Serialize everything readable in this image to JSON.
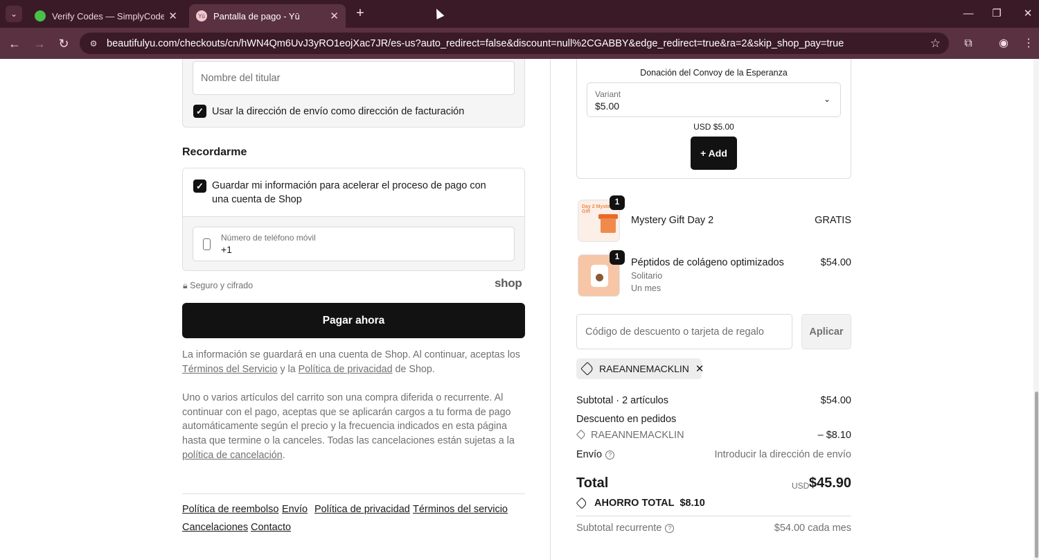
{
  "browser": {
    "tabs": [
      {
        "title": "Verify Codes — SimplyCodes",
        "active": false
      },
      {
        "title": "Pantalla de pago - Yū",
        "active": true
      }
    ],
    "url": "beautifulyu.com/checkouts/cn/hWN4Qm6UvJ3yRO1eojXac7JR/es-us?auto_redirect=false&discount=null%2CGABBY&edge_redirect=true&ra=2&skip_shop_pay=true"
  },
  "billing": {
    "holder_placeholder": "Nombre del titular",
    "use_shipping_label": "Usar la dirección de envío como dirección de facturación",
    "use_shipping_checked": true
  },
  "remember": {
    "heading": "Recordarme",
    "save_info_label": "Guardar mi información para acelerar el proceso de pago con una cuenta de Shop",
    "save_info_checked": true,
    "phone_label": "Número de teléfono móvil",
    "phone_value": "+1",
    "secure_text": "Seguro y cifrado",
    "shop_brand": "shop"
  },
  "pay_button": "Pagar ahora",
  "legal": {
    "para1_pre": "La información se guardará en una cuenta de Shop. Al continuar, aceptas los ",
    "terms_link": "Términos del Servicio",
    "para1_mid": " y la ",
    "privacy_link": "Política de privacidad",
    "para1_post": " de Shop.",
    "para2": "Uno o varios artículos del carrito son una compra diferida o recurrente. Al continuar con el pago, aceptas que se aplicarán cargos a tu forma de pago automáticamente según el precio y la frecuencia indicados en esta página hasta que termine o la canceles. Todas las cancelaciones están sujetas a la ",
    "cancel_policy_link": "política de cancelación",
    "para2_post": "."
  },
  "footer_links": [
    "Política de reembolso",
    "Envío",
    "Política de privacidad",
    "Términos del servicio",
    "Cancelaciones",
    "Contacto"
  ],
  "donation": {
    "title": "Donación del Convoy de la Esperanza",
    "variant_label": "Variant",
    "variant_value": "$5.00",
    "price": "USD $5.00",
    "add_label": "+ Add"
  },
  "cart_items": [
    {
      "name": "Mystery Gift Day 2",
      "qty": "1",
      "price": "GRATIS",
      "thumb_text": "Day 2 Mystery Gift"
    },
    {
      "name": "Péptidos de colágeno optimizados",
      "qty": "1",
      "price": "$54.00",
      "sub1": "Solitario",
      "sub2": "Un mes"
    }
  ],
  "discount": {
    "placeholder": "Código de descuento o tarjeta de regalo",
    "apply_label": "Aplicar",
    "applied_code": "RAEANNEMACKLIN"
  },
  "summary": {
    "subtotal_label": "Subtotal · 2 artículos",
    "subtotal_value": "$54.00",
    "order_discount_label": "Descuento en pedidos",
    "discount_code": "RAEANNEMACKLIN",
    "discount_value": "– $8.10",
    "shipping_label": "Envío",
    "shipping_value": "Introducir la dirección de envío",
    "total_label": "Total",
    "currency": "USD",
    "total_value": "$45.90",
    "savings_label": "AHORRO TOTAL",
    "savings_value": "$8.10",
    "recurring_label": "Subtotal recurrente",
    "recurring_value": "$54.00 cada mes"
  }
}
